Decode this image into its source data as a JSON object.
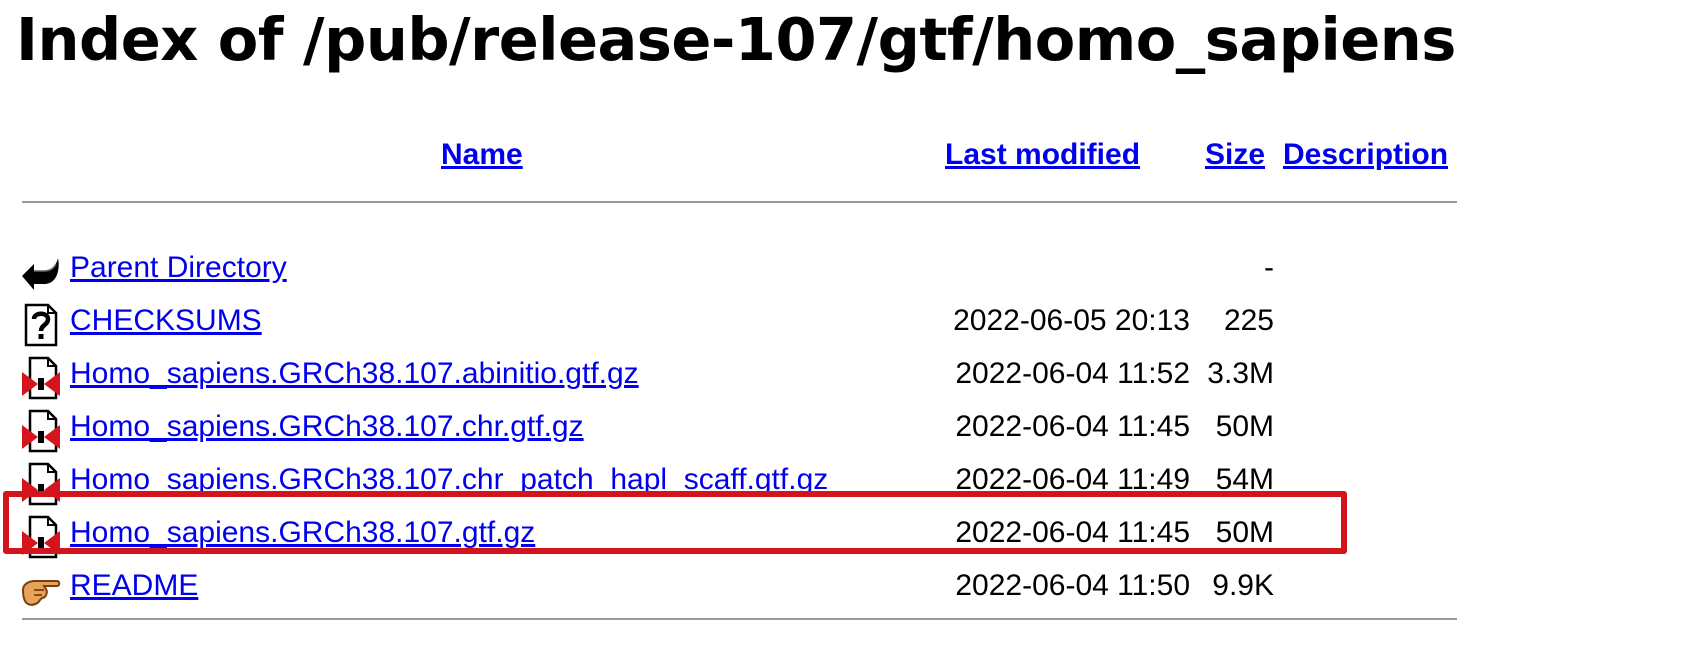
{
  "page": {
    "title": "Index of /pub/release-107/gtf/homo_sapiens"
  },
  "columns": {
    "name": "Name",
    "last_modified": "Last modified",
    "size": "Size",
    "description": "Description"
  },
  "rows": [
    {
      "icon": "back-arrow-icon",
      "name": "Parent Directory",
      "modified": "",
      "size": "-"
    },
    {
      "icon": "unknown-file-icon",
      "name": "CHECKSUMS",
      "modified": "2022-06-05 20:13",
      "size": "225"
    },
    {
      "icon": "compressed-file-icon",
      "name": "Homo_sapiens.GRCh38.107.abinitio.gtf.gz",
      "modified": "2022-06-04 11:52",
      "size": "3.3M"
    },
    {
      "icon": "compressed-file-icon",
      "name": "Homo_sapiens.GRCh38.107.chr.gtf.gz",
      "modified": "2022-06-04 11:45",
      "size": "50M"
    },
    {
      "icon": "compressed-file-icon",
      "name": "Homo_sapiens.GRCh38.107.chr_patch_hapl_scaff.gtf.gz",
      "modified": "2022-06-04 11:49",
      "size": "54M"
    },
    {
      "icon": "compressed-file-icon",
      "name": "Homo_sapiens.GRCh38.107.gtf.gz",
      "modified": "2022-06-04 11:45",
      "size": "50M"
    },
    {
      "icon": "pointing-hand-icon",
      "name": "README",
      "modified": "2022-06-04 11:50",
      "size": "9.9K"
    }
  ],
  "colors": {
    "link": "#0000ee",
    "highlight": "#d2141c",
    "rule": "#9a9a9a"
  }
}
